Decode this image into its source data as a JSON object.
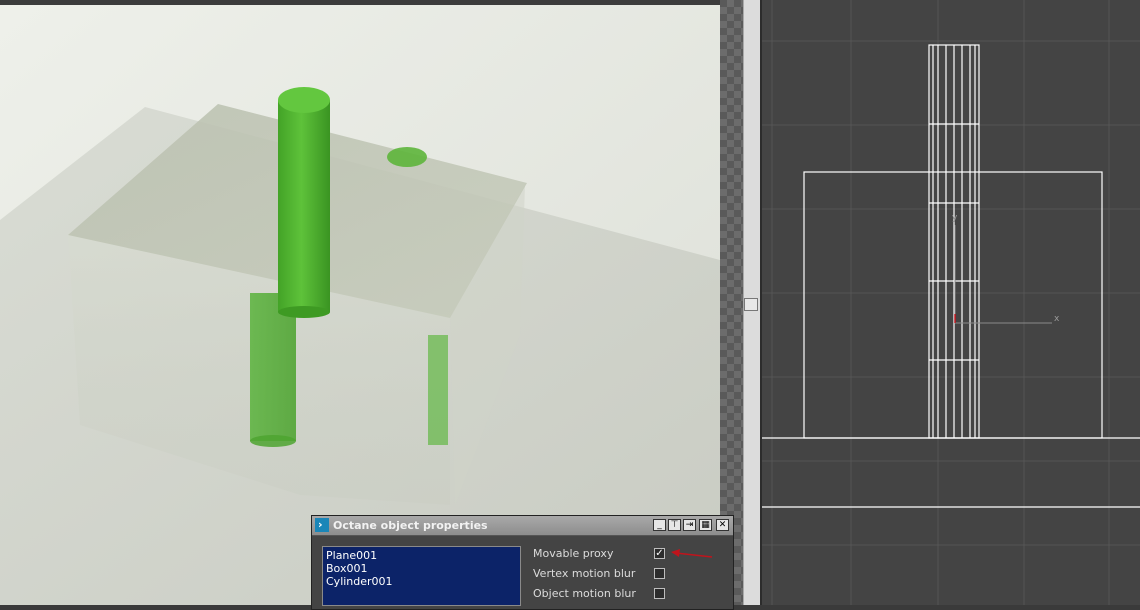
{
  "dialog": {
    "title": "Octane object properties",
    "controls": {
      "minimize_glyph": "_",
      "pin_glyph": "⊤",
      "dock_glyph": "⇥",
      "options_glyph": "▦",
      "close_glyph": "✕"
    },
    "objects": [
      "Plane001",
      "Box001",
      "Cylinder001"
    ],
    "options": [
      {
        "label": "Movable proxy",
        "checked": true
      },
      {
        "label": "Vertex motion blur",
        "checked": false
      },
      {
        "label": "Object motion blur",
        "checked": false
      }
    ],
    "check_glyph": "✓"
  },
  "ortho_viewport": {
    "axis_y_label": "y",
    "axis_x_label": "x"
  },
  "colors": {
    "accent_arrow": "#c0141c",
    "list_selection": "#0c2368",
    "cylinder_green": "#4cb52c",
    "viewport_grid": "#555555"
  },
  "icons": [
    "logo-icon",
    "minimize-icon",
    "pin-icon",
    "dock-icon",
    "options-icon",
    "close-icon",
    "arrow-annotation-icon"
  ]
}
